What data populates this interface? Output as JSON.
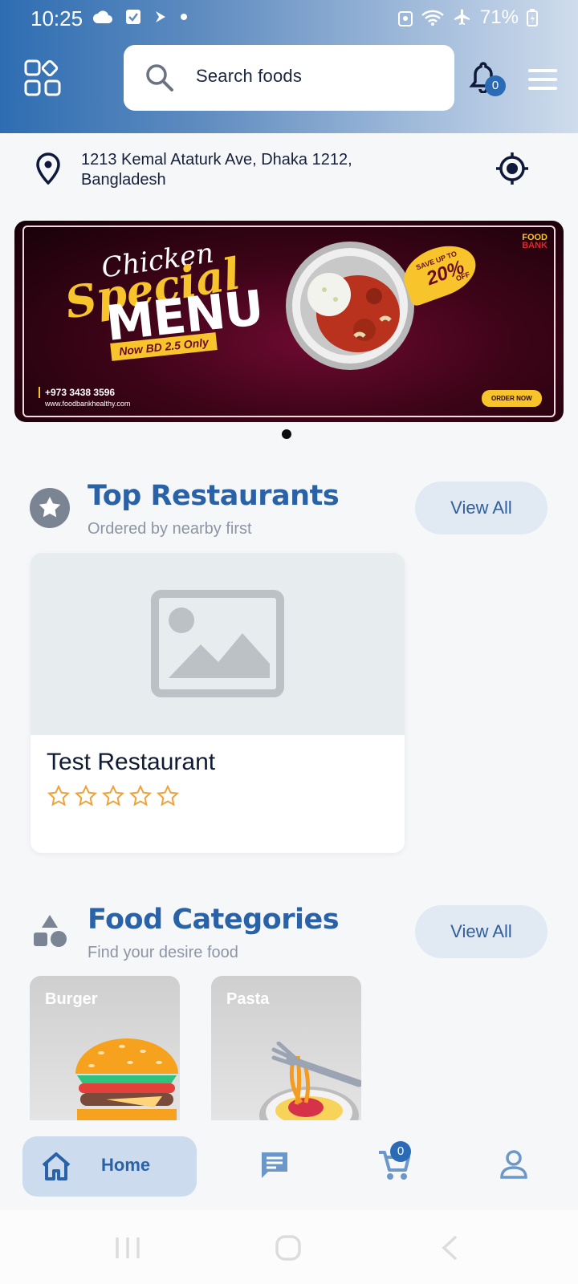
{
  "status_bar": {
    "time": "10:25",
    "battery": "71%",
    "left_icons": [
      "cloud-icon",
      "checkbox-icon",
      "arrow-icon",
      "dot-icon"
    ],
    "right_icons": [
      "vpn-icon",
      "wifi-icon",
      "airplane-icon",
      "battery-icon"
    ]
  },
  "header": {
    "search_placeholder": "Search foods",
    "notification_count": "0"
  },
  "address": {
    "line": "1213 Kemal Ataturk Ave, Dhaka 1212, Bangladesh"
  },
  "banner": {
    "chicken": "Chicken",
    "special": "Special",
    "menu": "MENU",
    "price": "Now BD 2.5 Only",
    "phone": "+973 3438 3596",
    "website": "www.foodbankhealthy.com",
    "brand_top": "FOOD",
    "brand_bottom": "BANK",
    "save_text": "SAVE UP TO",
    "save_value": "20%",
    "save_off": "OFF",
    "order_button": "ORDER NOW"
  },
  "top_restaurants": {
    "title": "Top Restaurants",
    "subtitle": "Ordered by nearby first",
    "view_all": "View All",
    "items": [
      {
        "name": "Test Restaurant",
        "rating": 0,
        "max_rating": 5
      }
    ]
  },
  "food_categories": {
    "title": "Food Categories",
    "subtitle": "Find your desire food",
    "view_all": "View All",
    "items": [
      {
        "label": "Burger"
      },
      {
        "label": "Pasta"
      }
    ]
  },
  "bottom_nav": {
    "home": "Home",
    "cart_count": "0"
  },
  "colors": {
    "primary": "#2a62a8",
    "star": "#f0a23a",
    "pill": "#ccdcee"
  }
}
